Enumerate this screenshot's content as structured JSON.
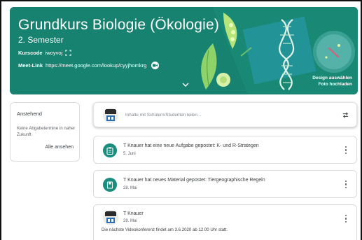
{
  "banner": {
    "title": "Grundkurs Biologie (Ökologie)",
    "subtitle": "2. Semester",
    "class_code_label": "Kurscode",
    "class_code": "iwoyvoj",
    "meet_label": "Meet-Link",
    "meet_url": "https://meet.google.com/lookup/cyyjhomkrg",
    "design_label": "Design auswählen",
    "upload_label": "Foto hochladen",
    "color": "#16826f"
  },
  "upcoming": {
    "title": "Anstehend",
    "empty_text": "Keine Abgabetermine in naher Zukunft",
    "view_all": "Alle ansehen"
  },
  "share": {
    "placeholder": "Inhalte mit Schülern/Studenten teilen..."
  },
  "stream": [
    {
      "type": "assignment",
      "icon": "assignment-icon",
      "title": "T Knauer hat eine neue Aufgabe gepostet: K- und R-Strategen",
      "date": "5. Juni"
    },
    {
      "type": "material",
      "icon": "material-icon",
      "title": "T Knauer hat neues Material gepostet: Tiergeographische Regeln",
      "date": "28. Mai"
    },
    {
      "type": "announcement",
      "author": "T Knauer",
      "date": "28. Mai",
      "body": "Die nächste Videokonferenz findet am 3.6.2020 ab 12.00 Uhr statt."
    }
  ],
  "colors": {
    "accent": "#1a8d7e",
    "border": "#dadce0",
    "text": "#3c4043",
    "muted": "#5f6368"
  }
}
